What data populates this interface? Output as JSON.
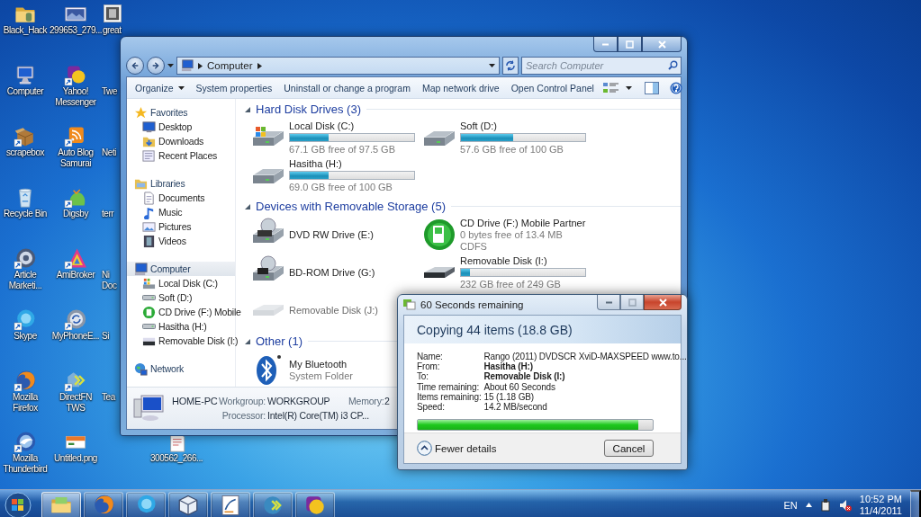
{
  "desktop": {
    "rows": [
      [
        {
          "kind": "folder",
          "label": "Black_Hack",
          "shortcut": false
        },
        {
          "kind": "image",
          "label": "299653_279...",
          "shortcut": false
        },
        {
          "kind": "photo",
          "label": "great",
          "shortcut": false
        }
      ],
      [
        {
          "kind": "computer",
          "label": "Computer",
          "shortcut": false
        },
        {
          "kind": "messenger",
          "label": "Yahoo! Messenger",
          "shortcut": true
        },
        {
          "kind": "hidden",
          "label": "Twe"
        }
      ],
      [
        {
          "kind": "package",
          "label": "scrapebox",
          "shortcut": true
        },
        {
          "kind": "feed",
          "label": "Auto Blog Samurai",
          "shortcut": true
        },
        {
          "kind": "hidden",
          "label": "Neti"
        }
      ],
      [
        {
          "kind": "recycle-bin",
          "label": "Recycle Bin",
          "shortcut": false
        },
        {
          "kind": "chat",
          "label": "Digsby",
          "shortcut": true
        },
        {
          "kind": "hidden",
          "label": "terr"
        }
      ],
      [
        {
          "kind": "disc",
          "label": "Article Marketi...",
          "shortcut": true
        },
        {
          "kind": "triangle",
          "label": "AmiBroker",
          "shortcut": true
        },
        {
          "kind": "hidden",
          "label": "Ni Doc"
        }
      ],
      [
        {
          "kind": "skype",
          "label": "Skype",
          "shortcut": true
        },
        {
          "kind": "sync",
          "label": "MyPhoneE...",
          "shortcut": true
        },
        {
          "kind": "hidden",
          "label": "Si"
        }
      ],
      [
        {
          "kind": "firefox",
          "label": "Mozilla Firefox",
          "shortcut": true
        },
        {
          "kind": "arrows",
          "label": "DirectFN TWS",
          "shortcut": true
        },
        {
          "kind": "hidden",
          "label": "Tea"
        }
      ],
      [
        {
          "kind": "thunderbird",
          "label": "Mozilla Thunderbird",
          "shortcut": true
        },
        {
          "kind": "png",
          "label": "Untitled.png",
          "shortcut": false
        },
        {
          "kind": "blank"
        },
        {
          "kind": "document",
          "label": "300562_266...",
          "shortcut": false
        }
      ]
    ]
  },
  "explorer": {
    "breadcrumb": "Computer",
    "search": {
      "placeholder": "Search Computer"
    },
    "toolbar": [
      {
        "kind": "menu",
        "label": "Organize"
      },
      {
        "kind": "command",
        "label": "System properties"
      },
      {
        "kind": "command",
        "label": "Uninstall or change a program"
      },
      {
        "kind": "command",
        "label": "Map network drive"
      },
      {
        "kind": "command",
        "label": "Open Control Panel"
      }
    ],
    "sidebar": [
      {
        "kind": "favorites",
        "label": "Favorites",
        "selected": false,
        "children": [
          {
            "kind": "desktop",
            "label": "Desktop",
            "selected": false
          },
          {
            "kind": "downloads",
            "label": "Downloads",
            "selected": false
          },
          {
            "kind": "recent",
            "label": "Recent Places",
            "selected": false
          }
        ]
      },
      {
        "kind": "libraries",
        "label": "Libraries",
        "selected": false,
        "children": [
          {
            "kind": "documents",
            "label": "Documents",
            "selected": false
          },
          {
            "kind": "music",
            "label": "Music",
            "selected": false
          },
          {
            "kind": "pictures",
            "label": "Pictures",
            "selected": false
          },
          {
            "kind": "videos",
            "label": "Videos",
            "selected": false
          }
        ]
      },
      {
        "kind": "computer",
        "label": "Computer",
        "selected": true,
        "children": [
          {
            "kind": "system-disk",
            "label": "Local Disk (C:)",
            "selected": false
          },
          {
            "kind": "disk",
            "label": "Soft (D:)",
            "selected": false
          },
          {
            "kind": "cd",
            "label": "CD Drive (F:) Mobile",
            "selected": false
          },
          {
            "kind": "disk",
            "label": "Hasitha (H:)",
            "selected": false
          },
          {
            "kind": "removable",
            "label": "Removable Disk (I:)",
            "selected": false
          }
        ]
      },
      {
        "kind": "network",
        "label": "Network",
        "selected": false
      }
    ],
    "groups": [
      {
        "title": "Hard Disk Drives (3)",
        "items": [
          {
            "kind": "system-disk",
            "name": "Local Disk (C:)",
            "level": 0.31,
            "info": [
              "67.1 GB free of 97.5 GB"
            ]
          },
          {
            "kind": "disk",
            "name": "Soft (D:)",
            "level": 0.42,
            "info": [
              "57.6 GB free of 100 GB"
            ]
          },
          {
            "kind": "disk",
            "name": "Hasitha (H:)",
            "level": 0.31,
            "info": [
              "69.0 GB free of 100 GB"
            ]
          }
        ]
      },
      {
        "title": "Devices with Removable Storage (5)",
        "items": [
          {
            "kind": "dvd",
            "name": "DVD RW Drive (E:)"
          },
          {
            "kind": "cd",
            "name": "CD Drive (F:) Mobile Partner",
            "info": [
              "0 bytes free of 13.4 MB",
              "CDFS"
            ]
          },
          {
            "kind": "bd",
            "name": "BD-ROM Drive (G:)"
          },
          {
            "kind": "removable",
            "name": "Removable Disk (I:)",
            "level": 0.07,
            "info": [
              "232 GB free of 249 GB"
            ]
          },
          {
            "kind": "removable-empty",
            "name": "Removable Disk (J:)"
          }
        ]
      },
      {
        "title": "Other (1)",
        "items": [
          {
            "kind": "bluetooth",
            "name": "My Bluetooth",
            "info": [
              "System Folder"
            ]
          }
        ]
      }
    ],
    "details": {
      "computer_name": "HOME-PC",
      "fields": [
        {
          "label": "Workgroup:",
          "value": "WORKGROUP"
        },
        {
          "label": "Memory:",
          "value": "2"
        },
        {
          "label": "Processor:",
          "value": "Intel(R) Core(TM) i3 CP..."
        }
      ]
    }
  },
  "copy_dialog": {
    "title": "60 Seconds remaining",
    "heading": "Copying 44 items (18.8 GB)",
    "details": [
      {
        "label": "Name:",
        "value": "Rango (2011) DVDSCR XviD-MAXSPEED www.to...",
        "bold": false
      },
      {
        "label": "From:",
        "value": "Hasitha (H:)",
        "bold": true
      },
      {
        "label": "To:",
        "value": "Removable Disk (I:)",
        "bold": true
      },
      {
        "label": "Time remaining:",
        "value": "About 60 Seconds",
        "bold": false
      },
      {
        "label": "Items remaining:",
        "value": "15 (1.18 GB)",
        "bold": false
      },
      {
        "label": "Speed:",
        "value": "14.2 MB/second",
        "bold": false
      }
    ],
    "progress": {
      "level": 0.94
    },
    "toggle": "Fewer details",
    "cancel": "Cancel"
  },
  "taskbar": {
    "buttons": [
      {
        "kind": "explorer",
        "active": true
      },
      {
        "kind": "firefox",
        "active": false
      },
      {
        "kind": "skype",
        "active": false
      },
      {
        "kind": "cube",
        "active": false
      },
      {
        "kind": "workbench",
        "active": false
      },
      {
        "kind": "tws",
        "active": false
      },
      {
        "kind": "messenger",
        "active": false
      }
    ],
    "language": "EN",
    "time": "10:52 PM",
    "date": "11/4/2011"
  }
}
